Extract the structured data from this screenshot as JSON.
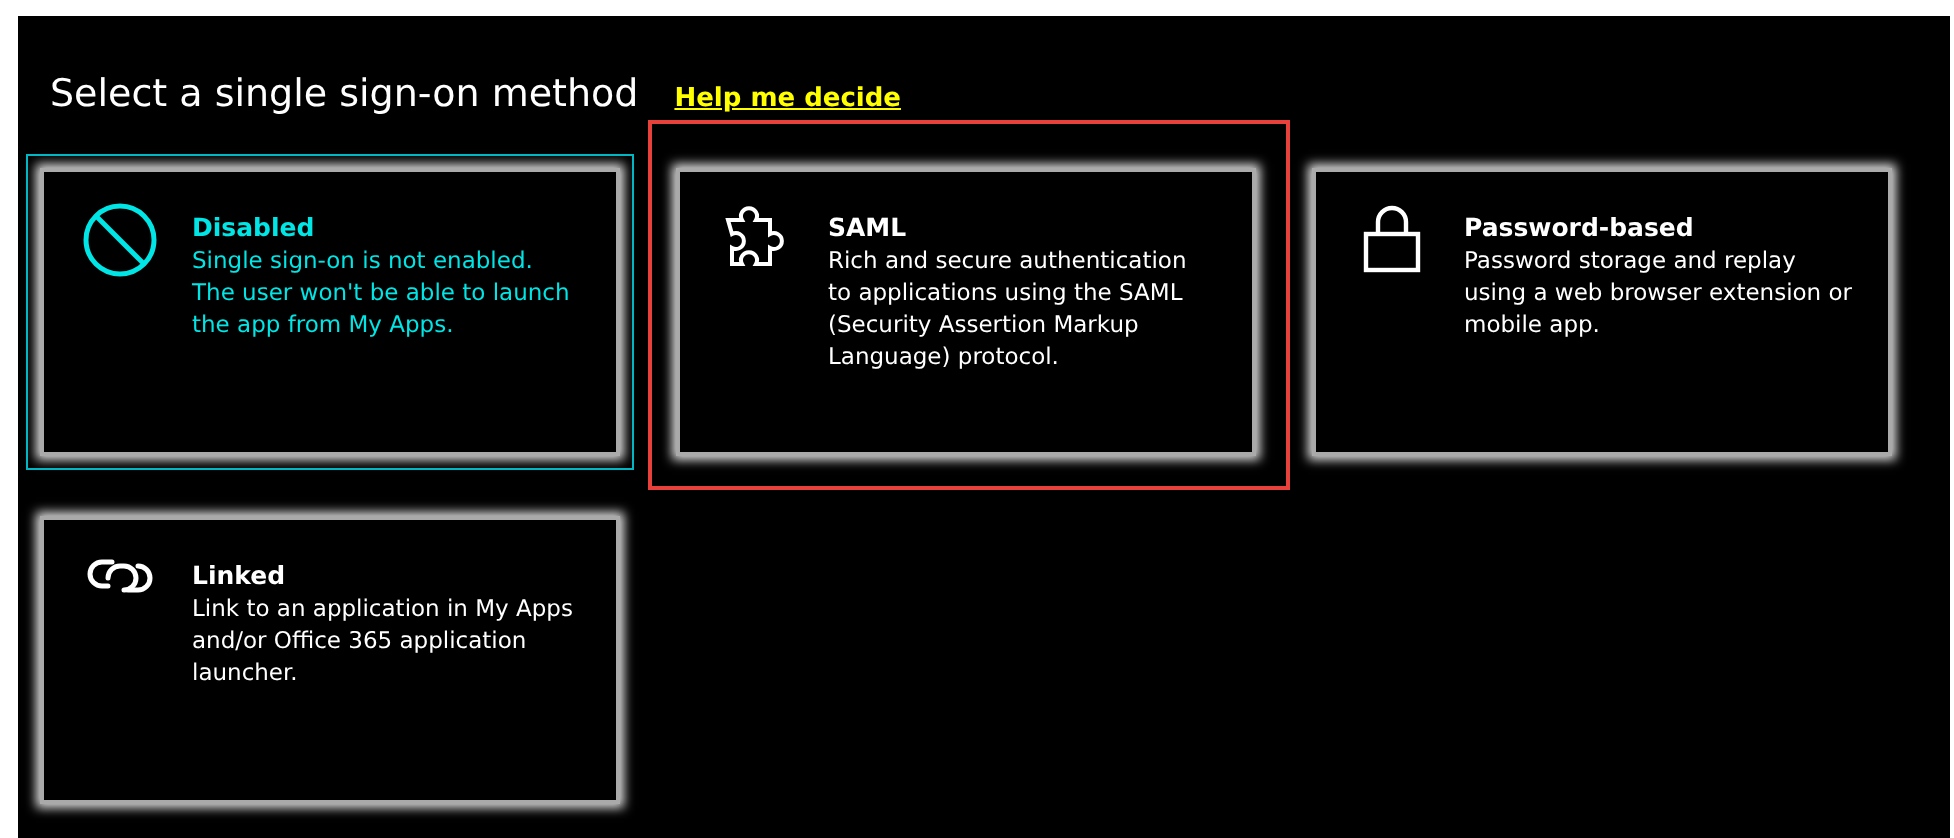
{
  "heading": "Select a single sign-on method",
  "help_link": "Help me decide",
  "methods": [
    {
      "kind": "disabled",
      "title": "Disabled",
      "description": "Single sign-on is not enabled. The user won't be able to launch the app from My Apps.",
      "selected": true,
      "highlighted": false
    },
    {
      "kind": "saml",
      "title": "SAML",
      "description": "Rich and secure authentication to applications using the SAML (Security Assertion Markup Language) protocol.",
      "selected": false,
      "highlighted": true
    },
    {
      "kind": "password",
      "title": "Password-based",
      "description": "Password storage and replay using a web browser extension or mobile app.",
      "selected": false,
      "highlighted": false
    },
    {
      "kind": "linked",
      "title": "Linked",
      "description": "Link to an application in My Apps and/or Office 365 application launcher.",
      "selected": false,
      "highlighted": false
    }
  ]
}
